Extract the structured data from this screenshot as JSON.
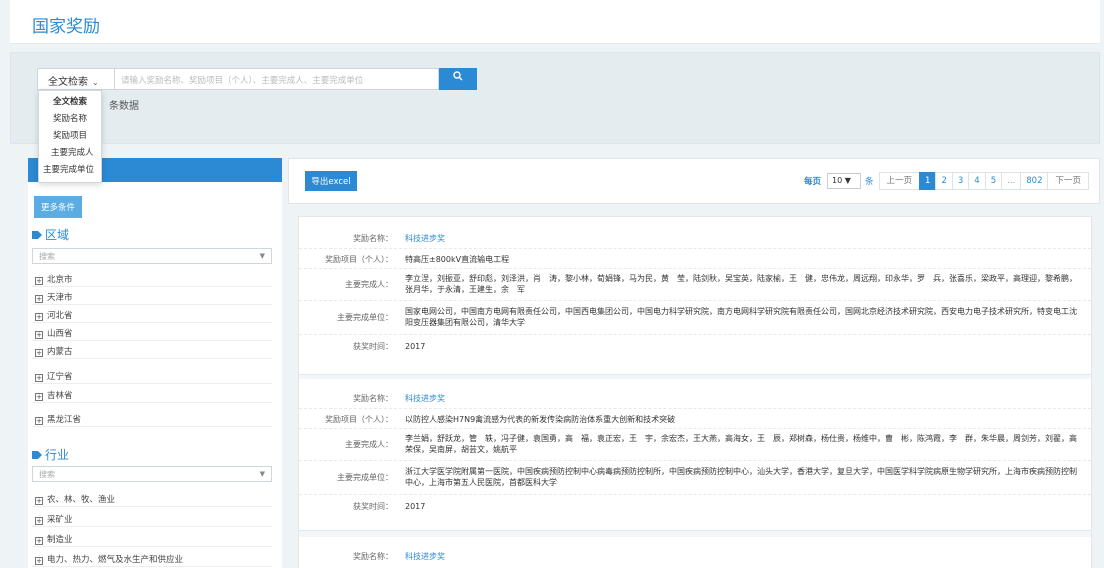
{
  "page_title": "国家奖励",
  "search": {
    "type_label": "全文检索",
    "placeholder": "请输入奖励名称、奖励项目（个人）、主要完成人、主要完成单位",
    "button_icon": "search-icon",
    "count_text": "条数据"
  },
  "dropdown": [
    "全文检索",
    "奖励名称",
    "奖励项目",
    "主要完成人",
    "主要完成单位"
  ],
  "sidebar": {
    "more_label": "更多条件",
    "region": {
      "title": "区域",
      "select_placeholder": "搜索",
      "items": [
        "北京市",
        "天津市",
        "河北省",
        "山西省",
        "内蒙古",
        "辽宁省",
        "吉林省",
        "黑龙江省"
      ]
    },
    "industry": {
      "title": "行业",
      "select_placeholder": "搜索",
      "items": [
        "农、林、牧、渔业",
        "采矿业",
        "制造业",
        "电力、热力、燃气及水生产和供应业"
      ]
    }
  },
  "toolbar": {
    "export_label": "导出excel",
    "per_page_label": "每页",
    "page_size": "10",
    "per_page_unit": "条",
    "prev_label": "上一页",
    "pages": [
      "1",
      "2",
      "3",
      "4",
      "5",
      "...",
      "802"
    ],
    "current_page": "1",
    "next_label": "下一页"
  },
  "labels": {
    "name": "奖励名称：",
    "project": "奖励项目（个人）：",
    "persons": "主要完成人：",
    "units": "主要完成单位：",
    "time": "获奖时间："
  },
  "records": [
    {
      "name": "科技进步奖",
      "project": "特高压±800kV直流输电工程",
      "persons": "李立浧，刘振亚，舒印彪，刘泽洪，肖　涛，黎小林，荀娟锋，马为民，黄　莹，陆剑秋，吴宝英，陆家榆，王　健，忠伟龙，周远翔，印永华，罗　兵，张喜乐，梁政平，高理迎，黎希鹏，张月华，于永清，王建生，余　军",
      "units": "国家电网公司，中国南方电网有限责任公司，中国西电集团公司，中国电力科学研究院，南方电网科学研究院有限责任公司，国网北京经济技术研究院，西安电力电子技术研究所，特变电工沈阳变压器集团有限公司，清华大学",
      "time": "2017"
    },
    {
      "name": "科技进步奖",
      "project": "以防控人感染H7N9禽流感为代表的新发传染病防治体系重大创新和技术突破",
      "persons": "李兰娟，舒跃龙，管　轶，冯子健，袁国勇，高　福，袁正宏，王　宇，余宏杰，王大燕，高海女，王　辰，郑树森，杨仕贵，杨维中，曹　彬，陈鸿霞，李　群，朱华晨，周剑芳，刘翟，高荣保，吴南屏，胡芸文，姚航平",
      "units": "浙江大学医学院附属第一医院，中国疾病预防控制中心病毒病预防控制所，中国疾病预防控制中心，汕头大学，香港大学，复旦大学，中国医学科学院病原生物学研究所，上海市疾病预防控制中心，上海市第五人民医院，首都医科大学",
      "time": "2017"
    },
    {
      "name": "科技进步奖"
    }
  ],
  "colors": {
    "accent": "#2b8ad3",
    "page_bg": "#eef3f6"
  }
}
